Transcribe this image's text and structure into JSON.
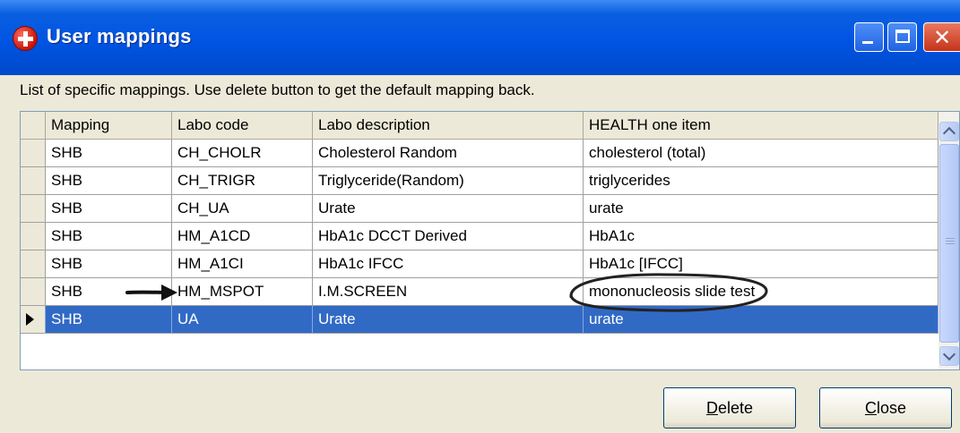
{
  "window": {
    "title": "User mappings",
    "app_icon": "red-cross-icon"
  },
  "description": "List of specific mappings. Use delete button to get the default mapping back.",
  "table": {
    "columns": [
      "Mapping",
      "Labo code",
      "Labo description",
      "HEALTH one item"
    ],
    "rows": [
      [
        "SHB",
        "CH_CHOLR",
        "Cholesterol Random",
        "cholesterol (total)"
      ],
      [
        "SHB",
        "CH_TRIGR",
        "Triglyceride(Random)",
        "triglycerides"
      ],
      [
        "SHB",
        "CH_UA",
        "Urate",
        "urate"
      ],
      [
        "SHB",
        "HM_A1CD",
        "HbA1c DCCT Derived",
        "HbA1c"
      ],
      [
        "SHB",
        "HM_A1CI",
        "HbA1c IFCC",
        "HbA1c [IFCC]"
      ],
      [
        "SHB",
        "HM_MSPOT",
        "I.M.SCREEN",
        "mononucleosis slide test"
      ],
      [
        "SHB",
        "UA",
        "Urate",
        "urate"
      ]
    ],
    "selected_row": 6
  },
  "buttons": {
    "delete_first": "D",
    "delete_rest": "elete",
    "close_first": "C",
    "close_rest": "lose"
  },
  "colors": {
    "titlebar": "#0054e3",
    "selection": "#316ac5",
    "background": "#ece9d8"
  }
}
